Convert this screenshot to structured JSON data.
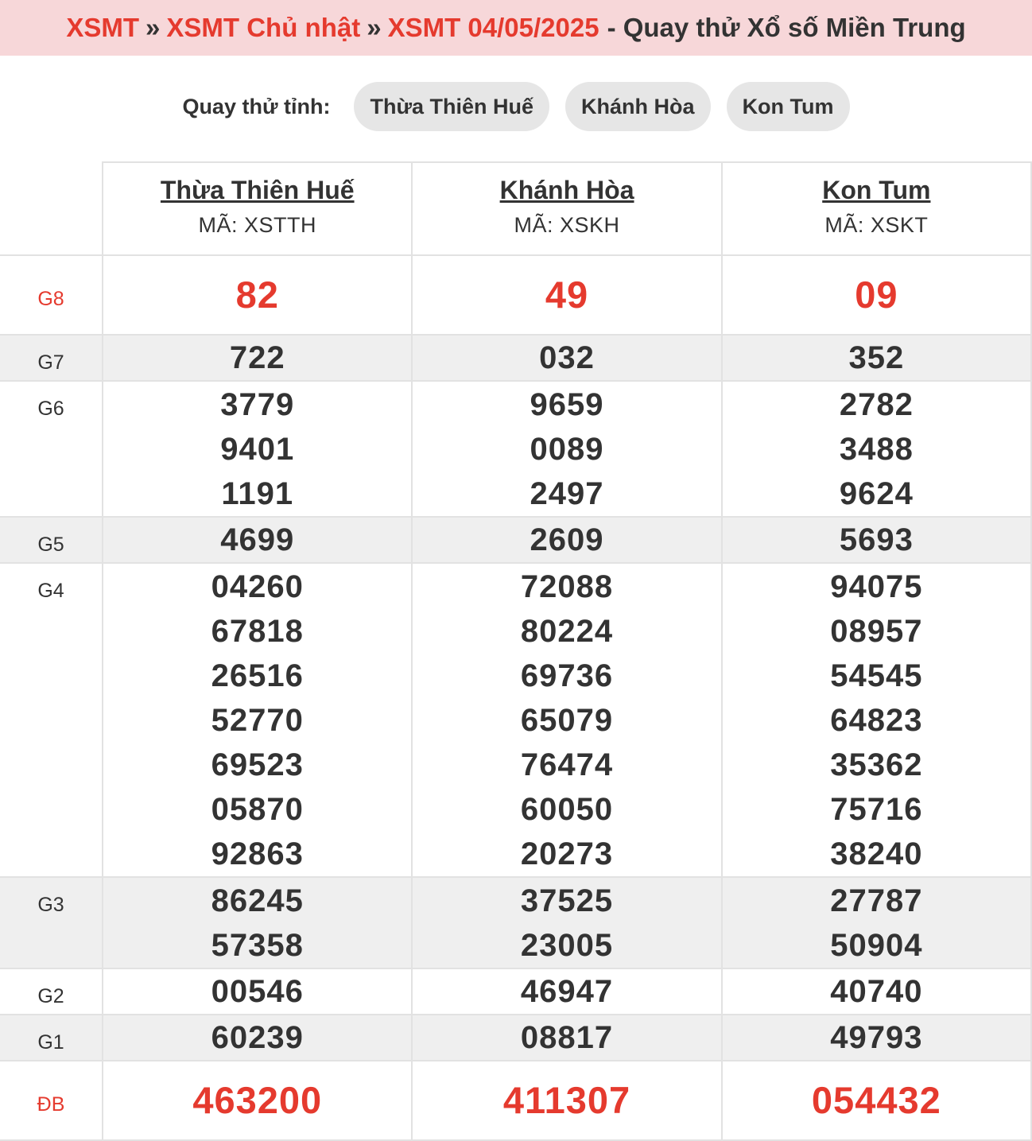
{
  "breadcrumb": {
    "items": [
      "XSMT",
      "XSMT Chủ nhật",
      "XSMT 04/05/2025"
    ],
    "separator": "»",
    "suffix": "- Quay thử Xổ số Miền Trung"
  },
  "filter": {
    "label": "Quay thử tỉnh:",
    "options": [
      "Thừa Thiên Huế",
      "Khánh Hòa",
      "Kon Tum"
    ]
  },
  "provinces": [
    {
      "name": "Thừa Thiên Huế",
      "code": "MÃ: XSTTH"
    },
    {
      "name": "Khánh Hòa",
      "code": "MÃ: XSKH"
    },
    {
      "name": "Kon Tum",
      "code": "MÃ: XSKT"
    }
  ],
  "prizes": [
    {
      "label": "G8",
      "values": [
        [
          "82"
        ],
        [
          "49"
        ],
        [
          "09"
        ]
      ]
    },
    {
      "label": "G7",
      "values": [
        [
          "722"
        ],
        [
          "032"
        ],
        [
          "352"
        ]
      ]
    },
    {
      "label": "G6",
      "values": [
        [
          "3779",
          "9401",
          "1191"
        ],
        [
          "9659",
          "0089",
          "2497"
        ],
        [
          "2782",
          "3488",
          "9624"
        ]
      ]
    },
    {
      "label": "G5",
      "values": [
        [
          "4699"
        ],
        [
          "2609"
        ],
        [
          "5693"
        ]
      ]
    },
    {
      "label": "G4",
      "values": [
        [
          "04260",
          "67818",
          "26516",
          "52770",
          "69523",
          "05870",
          "92863"
        ],
        [
          "72088",
          "80224",
          "69736",
          "65079",
          "76474",
          "60050",
          "20273"
        ],
        [
          "94075",
          "08957",
          "54545",
          "64823",
          "35362",
          "75716",
          "38240"
        ]
      ]
    },
    {
      "label": "G3",
      "values": [
        [
          "86245",
          "57358"
        ],
        [
          "37525",
          "23005"
        ],
        [
          "27787",
          "50904"
        ]
      ]
    },
    {
      "label": "G2",
      "values": [
        [
          "00546"
        ],
        [
          "46947"
        ],
        [
          "40740"
        ]
      ]
    },
    {
      "label": "G1",
      "values": [
        [
          "60239"
        ],
        [
          "08817"
        ],
        [
          "49793"
        ]
      ]
    },
    {
      "label": "ĐB",
      "values": [
        [
          "463200"
        ],
        [
          "411307"
        ],
        [
          "054432"
        ]
      ]
    }
  ],
  "colors": {
    "accent": "#e53a2e",
    "header_bg": "#f7d7d9",
    "pill_bg": "#e6e6e6",
    "row_shade": "#efefef"
  }
}
